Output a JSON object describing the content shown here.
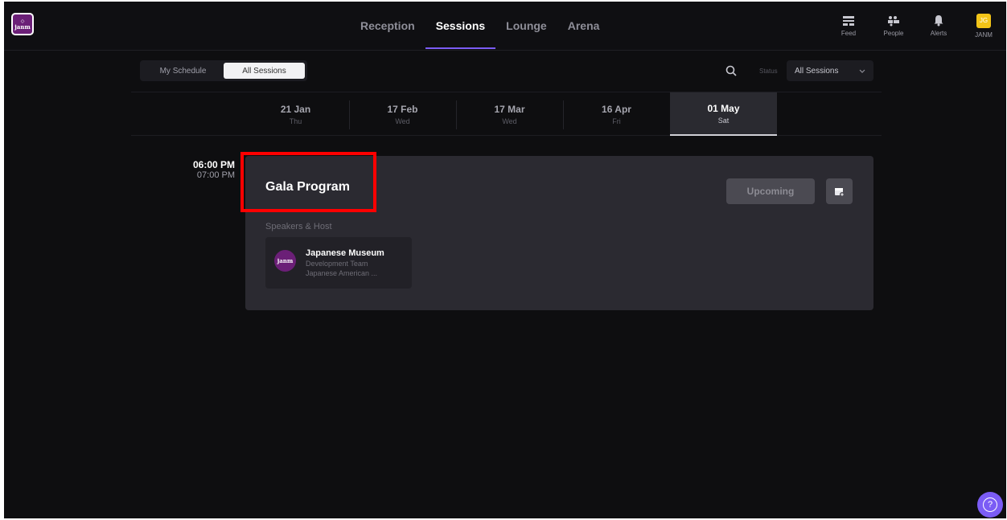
{
  "brand": {
    "logo_text": "janm"
  },
  "main_nav": [
    "Reception",
    "Sessions",
    "Lounge",
    "Arena"
  ],
  "right_nav": {
    "feed": "Feed",
    "people": "People",
    "alerts": "Alerts",
    "avatar_initials": "JG",
    "user": "JANM"
  },
  "view_toggle": {
    "my_schedule": "My Schedule",
    "all_sessions": "All Sessions"
  },
  "filter": {
    "status_label": "Status",
    "status_value": "All Sessions"
  },
  "dates": [
    {
      "date": "21 Jan",
      "day": "Thu"
    },
    {
      "date": "17 Feb",
      "day": "Wed"
    },
    {
      "date": "17 Mar",
      "day": "Wed"
    },
    {
      "date": "16 Apr",
      "day": "Fri"
    },
    {
      "date": "01 May",
      "day": "Sat"
    }
  ],
  "session": {
    "start_time": "06:00 PM",
    "end_time": "07:00 PM",
    "title": "Gala Program",
    "speakers_label": "Speakers & Host",
    "status_button": "Upcoming",
    "speaker": {
      "name": "Japanese Museum",
      "role": "Development Team",
      "org": "Japanese American ...",
      "avatar_text": "janm"
    }
  },
  "colors": {
    "accent": "#7b5cf5",
    "highlight": "#ff0000",
    "brand": "#6b1f77",
    "background": "#0e0e10"
  }
}
